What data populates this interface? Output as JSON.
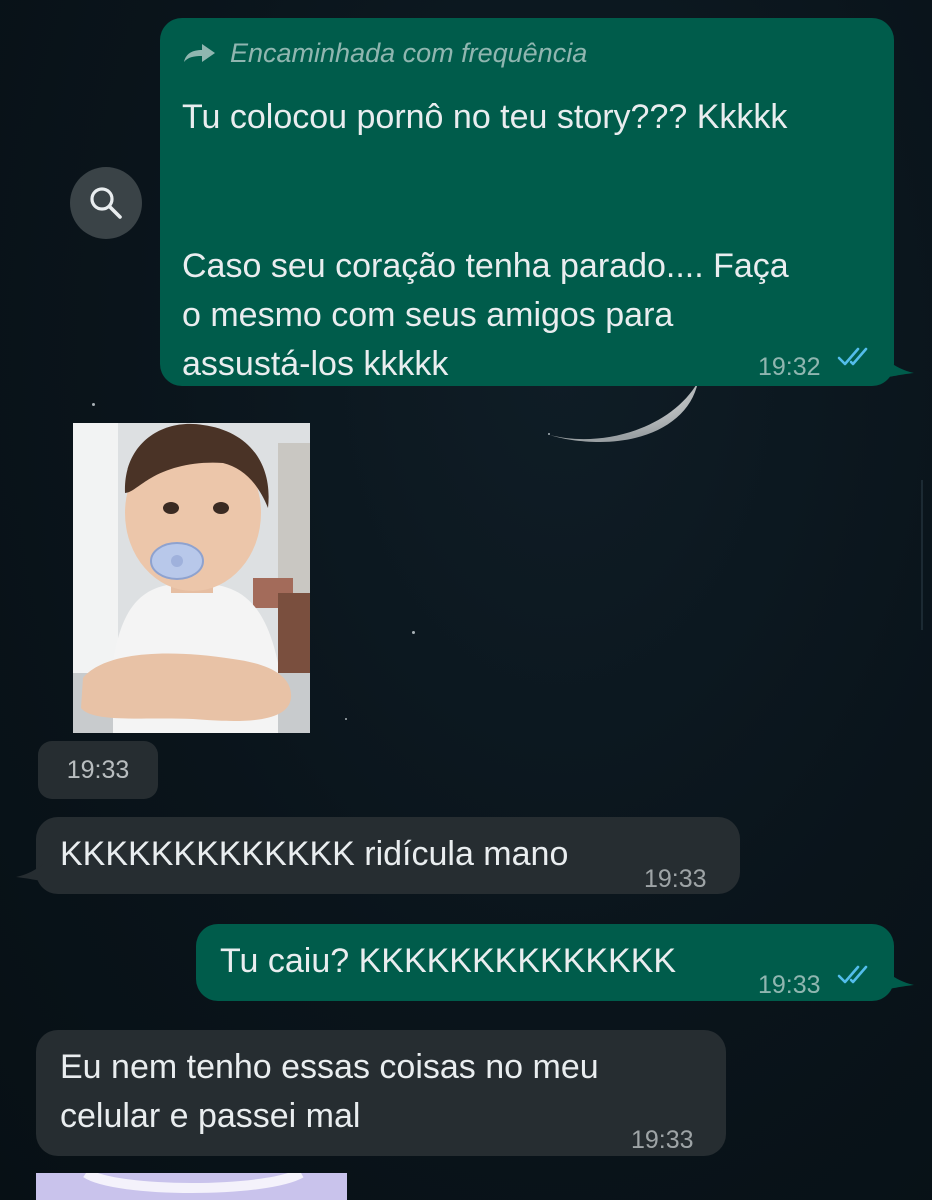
{
  "messages": [
    {
      "direction": "outgoing",
      "forwarded_label": "Encaminhada com frequência",
      "lines": [
        "Tu colocou pornô no teu story??? Kkkkk",
        "",
        "",
        "Caso seu coração tenha parado.... Faça",
        "o mesmo com seus amigos para",
        "assustá-los kkkkk"
      ],
      "time": "19:32",
      "status": "read"
    },
    {
      "direction": "incoming",
      "type": "image",
      "time": "19:33"
    },
    {
      "direction": "incoming",
      "lines": [
        "KKKKKKKKKKKKK ridícula mano"
      ],
      "time": "19:33"
    },
    {
      "direction": "outgoing",
      "lines": [
        "Tu caiu? KKKKKKKKKKKKKK"
      ],
      "time": "19:33",
      "status": "read"
    },
    {
      "direction": "incoming",
      "lines": [
        "Eu nem tenho essas coisas no meu",
        "celular e passei mal"
      ],
      "time": "19:33"
    }
  ],
  "icons": {
    "forward": "forward-arrow-icon",
    "search": "search-icon",
    "read_receipt": "double-check-icon"
  },
  "colors": {
    "outgoing_bubble": "#005c4b",
    "incoming_bubble": "#262d31",
    "read_ticks": "#53bdeb",
    "background": "#0b141a"
  }
}
